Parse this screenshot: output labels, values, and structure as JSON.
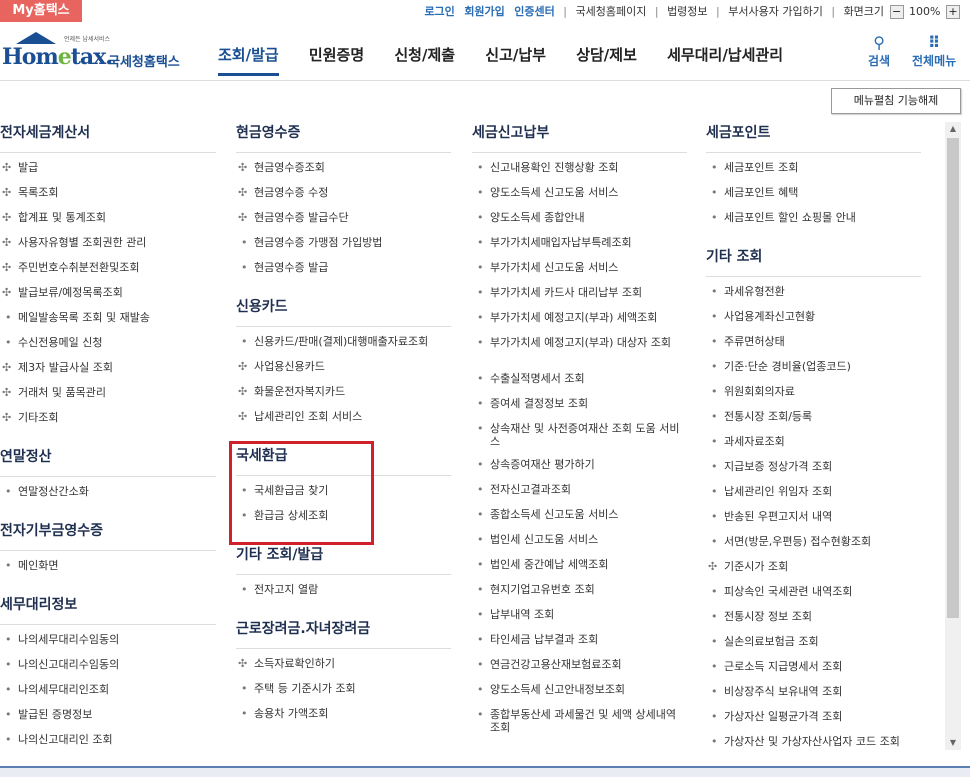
{
  "topbar": {
    "my_label": "My홈택스",
    "links_hl": [
      "로그인",
      "회원가입",
      "인증센터"
    ],
    "links_norm": [
      "국세청홈페이지",
      "법령정보",
      "부서사용자 가입하기",
      "화면크기"
    ],
    "zoom": "100%",
    "zoom_minus": "−",
    "zoom_plus": "+"
  },
  "header": {
    "logo_small": "언제든 납세서비스",
    "logo_en_1": "Hom",
    "logo_en_e": "e",
    "logo_en_2": "tax.",
    "logo_kr": "국세청홈택스",
    "nav": [
      "조회/발급",
      "민원증명",
      "신청/제출",
      "신고/납부",
      "상담/제보",
      "세무대리/납세관리"
    ],
    "search_label": "검색",
    "menu_label": "전체메뉴"
  },
  "collapse_button": "메뉴펼침 기능해제",
  "columns": [
    {
      "sections": [
        {
          "title": "전자세금계산서",
          "items": [
            {
              "m": "✣",
              "t": "발급"
            },
            {
              "m": "✣",
              "t": "목록조회"
            },
            {
              "m": "✣",
              "t": "합계표 및 통계조회"
            },
            {
              "m": "✣",
              "t": "사용자유형별 조회권한 관리"
            },
            {
              "m": "✣",
              "t": "주민번호수취분전환및조회"
            },
            {
              "m": "✣",
              "t": "발급보류/예정목록조회"
            },
            {
              "m": "•",
              "t": "메일발송목록 조회 및 재발송"
            },
            {
              "m": "•",
              "t": "수신전용메일 신청"
            },
            {
              "m": "✣",
              "t": "제3자 발급사실 조회"
            },
            {
              "m": "✣",
              "t": "거래처 및 품목관리"
            },
            {
              "m": "✣",
              "t": "기타조회"
            }
          ]
        },
        {
          "title": "연말정산",
          "items": [
            {
              "m": "•",
              "t": "연말정산간소화"
            }
          ]
        },
        {
          "title": "전자기부금영수증",
          "items": [
            {
              "m": "•",
              "t": "메인화면"
            }
          ]
        },
        {
          "title": "세무대리정보",
          "items": [
            {
              "m": "•",
              "t": "나의세무대리수임동의"
            },
            {
              "m": "•",
              "t": "나의신고대리수임동의"
            },
            {
              "m": "•",
              "t": "나의세무대리인조회"
            },
            {
              "m": "•",
              "t": "발급된 증명정보"
            },
            {
              "m": "•",
              "t": "나의신고대리인 조회"
            }
          ]
        }
      ]
    },
    {
      "sections": [
        {
          "title": "현금영수증",
          "items": [
            {
              "m": "✣",
              "t": "현금영수증조회"
            },
            {
              "m": "✣",
              "t": "현금영수증 수정"
            },
            {
              "m": "✣",
              "t": "현금영수증 발급수단"
            },
            {
              "m": "•",
              "t": "현금영수증 가맹점 가입방법"
            },
            {
              "m": "•",
              "t": "현금영수증 발급"
            }
          ]
        },
        {
          "title": "신용카드",
          "items": [
            {
              "m": "•",
              "t": "신용카드/판매(결제)대행매출자료조회"
            },
            {
              "m": "✣",
              "t": "사업용신용카드"
            },
            {
              "m": "✣",
              "t": "화물운전자복지카드"
            },
            {
              "m": "✣",
              "t": "납세관리인 조회 서비스"
            }
          ]
        },
        {
          "title": "국세환급",
          "items": [
            {
              "m": "•",
              "t": "국세환급금 찾기"
            },
            {
              "m": "•",
              "t": "환급금 상세조회"
            }
          ]
        },
        {
          "title": "기타 조회/발급",
          "items": [
            {
              "m": "•",
              "t": "전자고지 열람"
            }
          ]
        },
        {
          "title": "근로장려금.자녀장려금",
          "items": [
            {
              "m": "✣",
              "t": "소득자료확인하기"
            },
            {
              "m": "•",
              "t": "주택 등 기준시가 조회"
            },
            {
              "m": "•",
              "t": "송용차 가액조회"
            }
          ]
        }
      ]
    },
    {
      "sections": [
        {
          "title": "세금신고납부",
          "items": [
            {
              "m": "•",
              "t": "신고내용확인 진행상황 조회"
            },
            {
              "m": "•",
              "t": "양도소득세 신고도움 서비스"
            },
            {
              "m": "•",
              "t": "양도소득세 종합안내"
            },
            {
              "m": "•",
              "t": "부가가치세매입자납부특례조회"
            },
            {
              "m": "•",
              "t": "부가가치세 신고도움 서비스"
            },
            {
              "m": "•",
              "t": "부가가치세 카드사 대리납부 조회"
            },
            {
              "m": "•",
              "t": "부가가치세 예정고지(부과) 세액조회"
            },
            {
              "m": "•",
              "t": "부가가치세 예정고지(부과) 대상자 조회",
              "two": true
            },
            {
              "m": "•",
              "t": "수출실적명세서 조회"
            },
            {
              "m": "•",
              "t": "증여세 결정정보 조회"
            },
            {
              "m": "•",
              "t": "상속재산 및 사전증여재산 조회 도움 서비스",
              "two": true
            },
            {
              "m": "•",
              "t": "상속증여재산 평가하기"
            },
            {
              "m": "•",
              "t": "전자신고결과조회"
            },
            {
              "m": "•",
              "t": "종합소득세 신고도움 서비스"
            },
            {
              "m": "•",
              "t": "법인세 신고도움 서비스"
            },
            {
              "m": "•",
              "t": "법인세 중간예납 세액조회"
            },
            {
              "m": "•",
              "t": "현지기업고유번호 조회"
            },
            {
              "m": "•",
              "t": "납부내역 조회"
            },
            {
              "m": "•",
              "t": "타인세금 납부결과 조회"
            },
            {
              "m": "•",
              "t": "연금건강고용산재보험료조회"
            },
            {
              "m": "•",
              "t": "양도소득세 신고안내정보조회"
            },
            {
              "m": "•",
              "t": "종합부동산세 과세물건 및 세액 상세내역 조회",
              "two": true
            }
          ]
        }
      ]
    },
    {
      "sections": [
        {
          "title": "세금포인트",
          "items": [
            {
              "m": "•",
              "t": "세금포인트 조회"
            },
            {
              "m": "•",
              "t": "세금포인트 혜택"
            },
            {
              "m": "•",
              "t": "세금포인트 할인 쇼핑몰 안내"
            }
          ]
        },
        {
          "title": "기타 조회",
          "items": [
            {
              "m": "•",
              "t": "과세유형전환"
            },
            {
              "m": "•",
              "t": "사업용계좌신고현황"
            },
            {
              "m": "•",
              "t": "주류면허상태"
            },
            {
              "m": "•",
              "t": "기준·단순 경비율(업종코드)"
            },
            {
              "m": "•",
              "t": "위원회회의자료"
            },
            {
              "m": "•",
              "t": "전통시장 조회/등록"
            },
            {
              "m": "•",
              "t": "과세자료조회"
            },
            {
              "m": "•",
              "t": "지급보증 정상가격 조회"
            },
            {
              "m": "•",
              "t": "납세관리인 위임자 조회"
            },
            {
              "m": "•",
              "t": "반송된 우편고지서 내역"
            },
            {
              "m": "•",
              "t": "서면(방문,우편등) 접수현황조회"
            },
            {
              "m": "✣",
              "t": "기준시가 조회"
            },
            {
              "m": "•",
              "t": "피상속인 국세관련 내역조회"
            },
            {
              "m": "•",
              "t": "전통시장 정보 조회"
            },
            {
              "m": "•",
              "t": "실손의료보험금 조회"
            },
            {
              "m": "•",
              "t": "근로소득 지급명세서 조회"
            },
            {
              "m": "•",
              "t": "비상장주식 보유내역 조회"
            },
            {
              "m": "•",
              "t": "가상자산 일평균가격 조회"
            },
            {
              "m": "•",
              "t": "가상자산 및 가상자산사업자 코드 조회"
            }
          ]
        }
      ]
    }
  ]
}
